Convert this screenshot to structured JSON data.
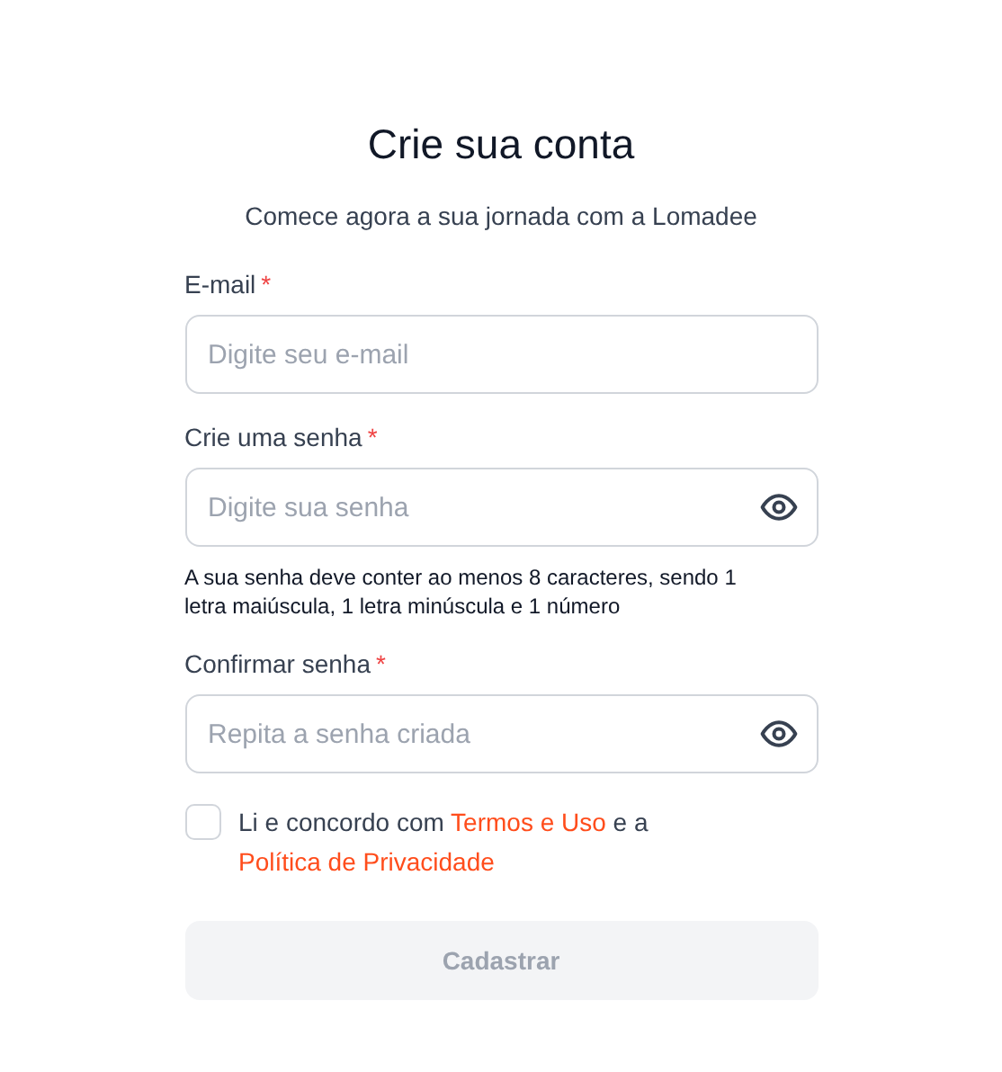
{
  "title": "Crie sua conta",
  "subtitle": "Comece agora a sua jornada com a Lomadee",
  "fields": [
    {
      "kind": "email",
      "label": "E-mail",
      "required_mark": "*",
      "placeholder": "Digite seu e-mail"
    },
    {
      "kind": "password",
      "label": "Crie uma senha",
      "required_mark": "*",
      "placeholder": "Digite sua senha",
      "hint": "A sua senha deve conter ao menos 8 caracteres, sendo 1 letra maiúscula, 1 letra minúscula e 1 número"
    },
    {
      "kind": "password",
      "label": "Confirmar senha",
      "required_mark": "*",
      "placeholder": "Repita a senha criada"
    }
  ],
  "agreement": {
    "checked": false,
    "parts": [
      {
        "kind": "text",
        "text": "Li e concordo com"
      },
      {
        "kind": "link",
        "text": "Termos e Uso"
      },
      {
        "kind": "text",
        "text": "e a"
      },
      {
        "kind": "link",
        "text": "Política de Privacidade"
      }
    ]
  },
  "submit": {
    "label": "Cadastrar",
    "disabled": true
  }
}
